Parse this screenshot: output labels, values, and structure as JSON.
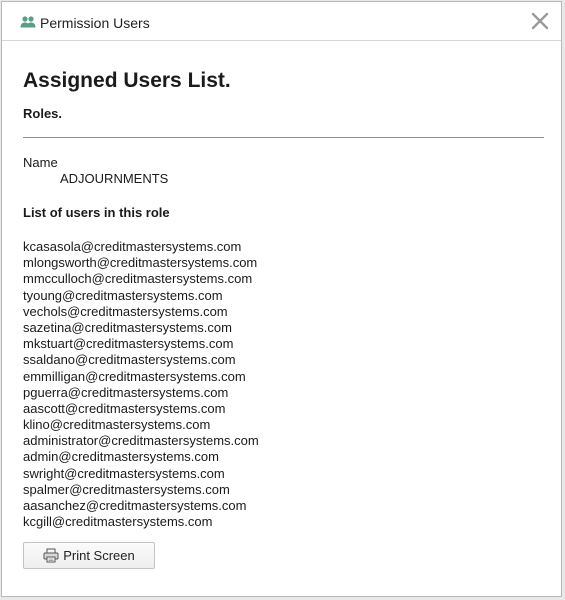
{
  "dialog": {
    "title": "Permission Users",
    "title_icon": "users-icon",
    "close_icon": "close-icon"
  },
  "main": {
    "heading": "Assigned Users List.",
    "roles_label": "Roles.",
    "name_label": "Name",
    "name_value": "ADJOURNMENTS",
    "users_heading": "List of users in this role",
    "users": [
      "kcasasola@creditmastersystems.com",
      "mlongsworth@creditmastersystems.com",
      "mmcculloch@creditmastersystems.com",
      "tyoung@creditmastersystems.com",
      "vechols@creditmastersystems.com",
      "sazetina@creditmastersystems.com",
      "mkstuart@creditmastersystems.com",
      "ssaldano@creditmastersystems.com",
      "emmilligan@creditmastersystems.com",
      "pguerra@creditmastersystems.com",
      "aascott@creditmastersystems.com",
      "klino@creditmastersystems.com",
      "administrator@creditmastersystems.com",
      "admin@creditmastersystems.com",
      "swright@creditmastersystems.com",
      "spalmer@creditmastersystems.com",
      "aasanchez@creditmastersystems.com",
      "kcgill@creditmastersystems.com"
    ]
  },
  "footer": {
    "print_label": "Print Screen",
    "print_icon": "printer-icon"
  },
  "colors": {
    "icon_green": "#5a9e86",
    "close_gray": "#9a9a9a",
    "divider": "#8d8d8d"
  }
}
